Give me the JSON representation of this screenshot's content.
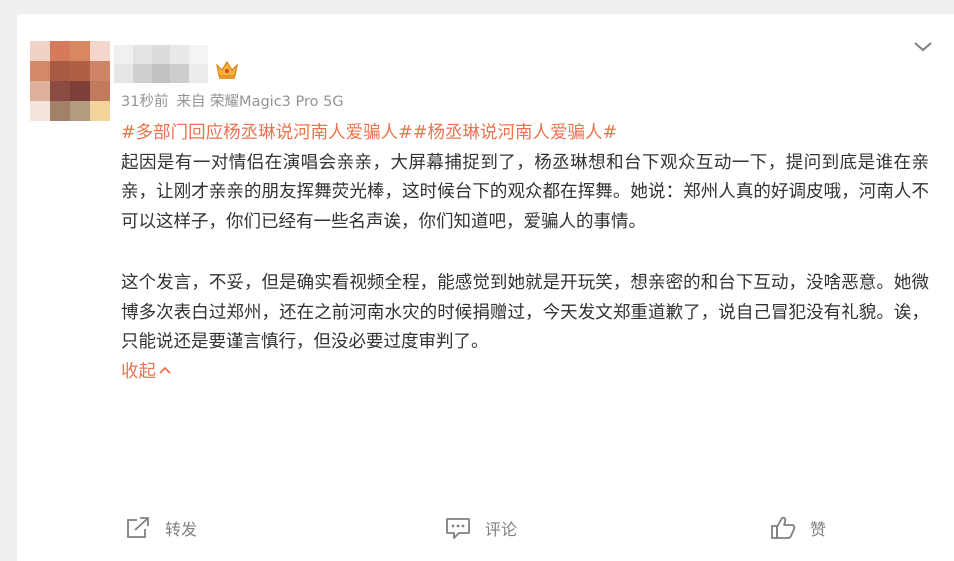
{
  "post": {
    "time": "31秒前",
    "source": "来自 荣耀Magic3 Pro 5G",
    "hashtags": [
      "#多部门回应杨丞琳说河南人爱骗人#",
      "#杨丞琳说河南人爱骗人#"
    ],
    "paragraphs": [
      "起因是有一对情侣在演唱会亲亲，大屏幕捕捉到了，杨丞琳想和台下观众互动一下，提问到底是谁在亲亲，让刚才亲亲的朋友挥舞荧光棒，这时候台下的观众都在挥舞。她说：郑州人真的好调皮哦，河南人不可以这样子，你们已经有一些名声诶，你们知道吧，爱骗人的事情。",
      "这个发言，不妥，但是确实看视频全程，能感觉到她就是开玩笑，想亲密的和台下互动，没啥恶意。她微博多次表白过郑州，还在之前河南水灾的时候捐赠过，今天发文郑重道歉了，说自己冒犯没有礼貌。诶，只能说还是要谨言慎行，但没必要过度审判了。"
    ],
    "collapse_label": "收起"
  },
  "actions": {
    "repost": "转发",
    "comment": "评论",
    "like": "赞"
  },
  "icons": {
    "more": "chevron-down-icon",
    "badge": "crown-icon",
    "repost": "share-icon",
    "comment": "comment-icon",
    "like": "thumbs-up-icon"
  },
  "colors": {
    "link": "#eb7350",
    "text": "#333333",
    "meta": "#939393",
    "background": "#efefef"
  }
}
